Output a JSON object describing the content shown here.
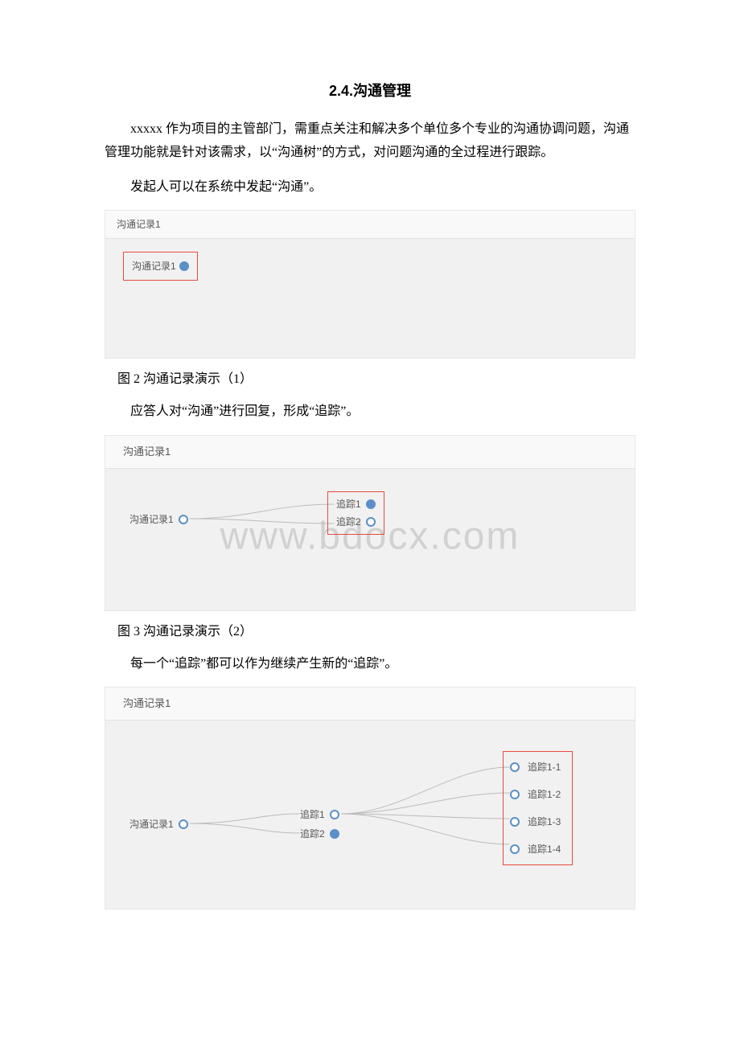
{
  "title": "2.4.沟通管理",
  "para_intro": "xxxxx 作为项目的主管部门，需重点关注和解决多个单位多个专业的沟通协调问题，沟通管理功能就是针对该需求，以“沟通树”的方式，对问题沟通的全过程进行跟踪。",
  "para_a": "发起人可以在系统中发起“沟通”。",
  "panel1": {
    "tab": "沟通记录1",
    "node": "沟通记录1"
  },
  "cap1": "图 2 沟通记录演示（1）",
  "para_b": "应答人对“沟通”进行回复，形成“追踪”。",
  "panel2": {
    "tab": "沟通记录1",
    "root": "沟通记录1",
    "t1": "追踪1",
    "t2": "追踪2",
    "watermark": "www.bdocx.com"
  },
  "cap2": "图 3 沟通记录演示（2）",
  "para_c": "每一个“追踪”都可以作为继续产生新的“追踪”。",
  "panel3": {
    "tab": "沟通记录1",
    "root": "沟通记录1",
    "t1": "追踪1",
    "t2": "追踪2",
    "leaf1": "追踪1-1",
    "leaf2": "追踪1-2",
    "leaf3": "追踪1-3",
    "leaf4": "追踪1-4"
  }
}
